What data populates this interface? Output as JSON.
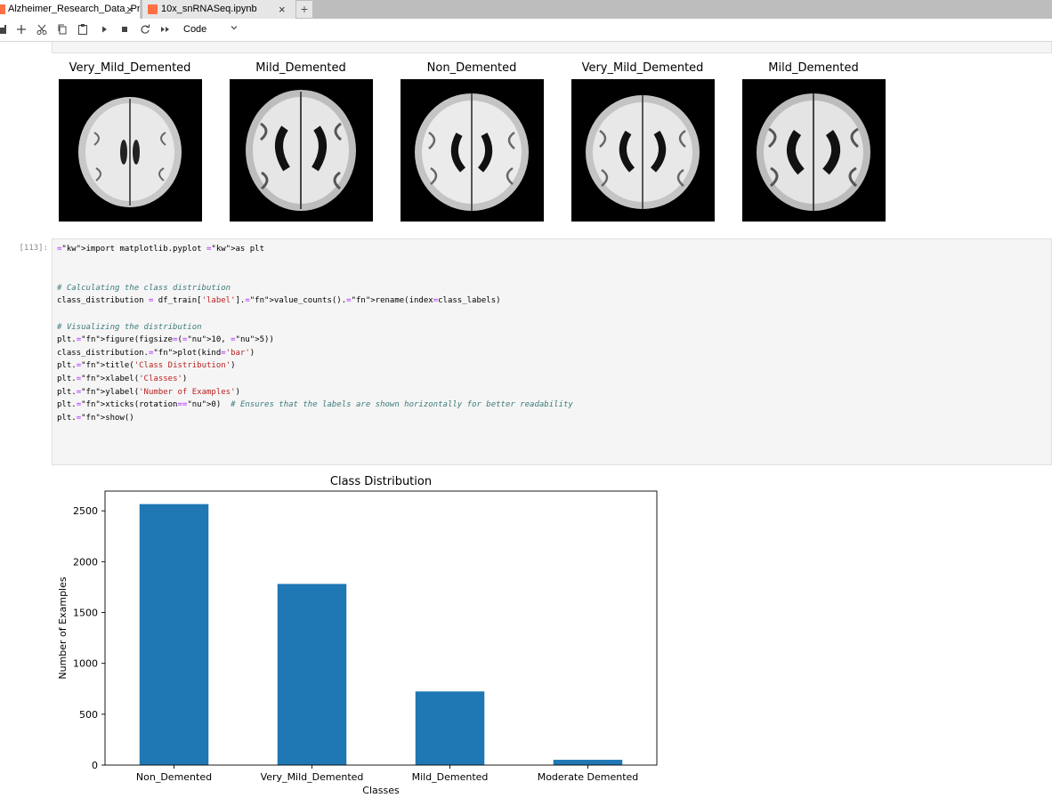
{
  "tabs": [
    {
      "label": "Alzheimer_Research_Data_Pr",
      "close": "×",
      "active": true
    },
    {
      "label": "10x_snRNASeq.ipynb",
      "close": "×",
      "active": false
    }
  ],
  "new_tab_label": "+",
  "toolbar": {
    "icons": [
      "save-icon",
      "add-icon",
      "cut-icon",
      "copy-icon",
      "paste-icon",
      "run-icon",
      "stop-icon",
      "restart-icon",
      "fast-forward-icon"
    ],
    "cell_type": "Code"
  },
  "images": [
    {
      "title": "Very_Mild_Demented"
    },
    {
      "title": "Mild_Demented"
    },
    {
      "title": "Non_Demented"
    },
    {
      "title": "Very_Mild_Demented"
    },
    {
      "title": "Mild_Demented"
    }
  ],
  "code_cell": {
    "prompt": "[113]:",
    "lines": [
      "import matplotlib.pyplot as plt",
      "",
      "",
      "# Calculating the class distribution",
      "class_distribution = df_train['label'].value_counts().rename(index=class_labels)",
      "",
      "# Visualizing the distribution",
      "plt.figure(figsize=(10, 5))",
      "class_distribution.plot(kind='bar')",
      "plt.title('Class Distribution')",
      "plt.xlabel('Classes')",
      "plt.ylabel('Number of Examples')",
      "plt.xticks(rotation=0)  # Ensures that the labels are shown horizontally for better readability",
      "plt.show()"
    ]
  },
  "chart_data": {
    "type": "bar",
    "title": "Class Distribution",
    "xlabel": "Classes",
    "ylabel": "Number of Examples",
    "categories": [
      "Non_Demented",
      "Very_Mild_Demented",
      "Mild_Demented",
      "Moderate Demented"
    ],
    "values": [
      2566,
      1781,
      724,
      52
    ],
    "ylim": [
      0,
      2694
    ],
    "yticks": [
      0,
      500,
      1000,
      1500,
      2000,
      2500
    ],
    "color": "#1f77b4",
    "grid": false
  }
}
